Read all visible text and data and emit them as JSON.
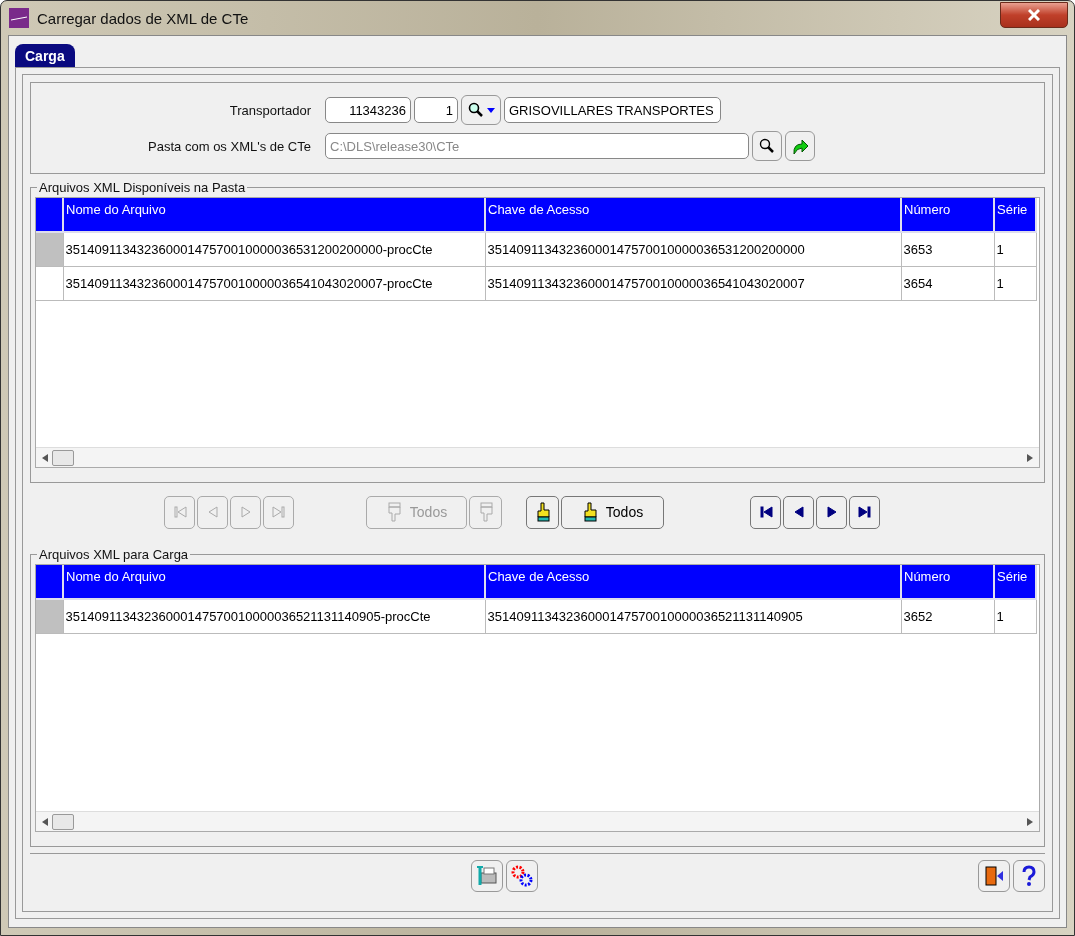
{
  "window": {
    "title": "Carregar dados de XML de CTe"
  },
  "tabs": [
    {
      "label": "Carga",
      "selected": true
    }
  ],
  "header": {
    "carrier": {
      "label": "Transportador",
      "code": "11343236",
      "branch": "1",
      "name": "GRISOVILLARES TRANSPORTES"
    },
    "folder": {
      "label": "Pasta com os XML's de CTe",
      "value": "C:\\DLS\\release30\\CTe",
      "disabled": true
    }
  },
  "available": {
    "title": "Arquivos XML Disponíveis na Pasta",
    "columns": [
      "Nome do Arquivo",
      "Chave de Acesso",
      "Número",
      "Série"
    ],
    "rows": [
      {
        "selected": true,
        "cells": [
          "35140911343236000147570010000036531200200000-procCte",
          "35140911343236000147570010000036531200200000",
          "3653",
          "1"
        ]
      },
      {
        "selected": false,
        "cells": [
          "35140911343236000147570010000036541043020007-procCte",
          "35140911343236000147570010000036541043020007",
          "3654",
          "1"
        ]
      }
    ]
  },
  "move_buttons": [
    {
      "buttons": [
        {
          "kind": "first",
          "disabled": true
        },
        {
          "kind": "prev",
          "disabled": true
        },
        {
          "kind": "next",
          "disabled": true
        },
        {
          "kind": "last",
          "disabled": true
        }
      ]
    },
    {
      "buttons": [
        {
          "kind": "remove",
          "label": "Todos",
          "disabled": true
        },
        {
          "kind": "remove",
          "disabled": true
        }
      ]
    },
    {
      "buttons": [
        {
          "kind": "add",
          "disabled": false
        },
        {
          "kind": "add",
          "label": "Todos",
          "disabled": false
        }
      ]
    },
    {
      "buttons": [
        {
          "kind": "first",
          "disabled": false
        },
        {
          "kind": "prev",
          "disabled": false
        },
        {
          "kind": "next",
          "disabled": false
        },
        {
          "kind": "last",
          "disabled": false
        }
      ]
    }
  ],
  "load": {
    "title": "Arquivos XML para Carga",
    "columns": [
      "Nome do Arquivo",
      "Chave de Acesso",
      "Número",
      "Série"
    ],
    "rows": [
      {
        "selected": true,
        "cells": [
          "35140911343236000147570010000036521131140905-procCte",
          "35140911343236000147570010000036521131140905",
          "3652",
          "1"
        ]
      }
    ]
  },
  "footer_buttons": [
    {
      "kind": "tools"
    },
    {
      "kind": "process"
    }
  ],
  "corner_buttons": [
    {
      "kind": "exit"
    },
    {
      "kind": "help"
    }
  ]
}
